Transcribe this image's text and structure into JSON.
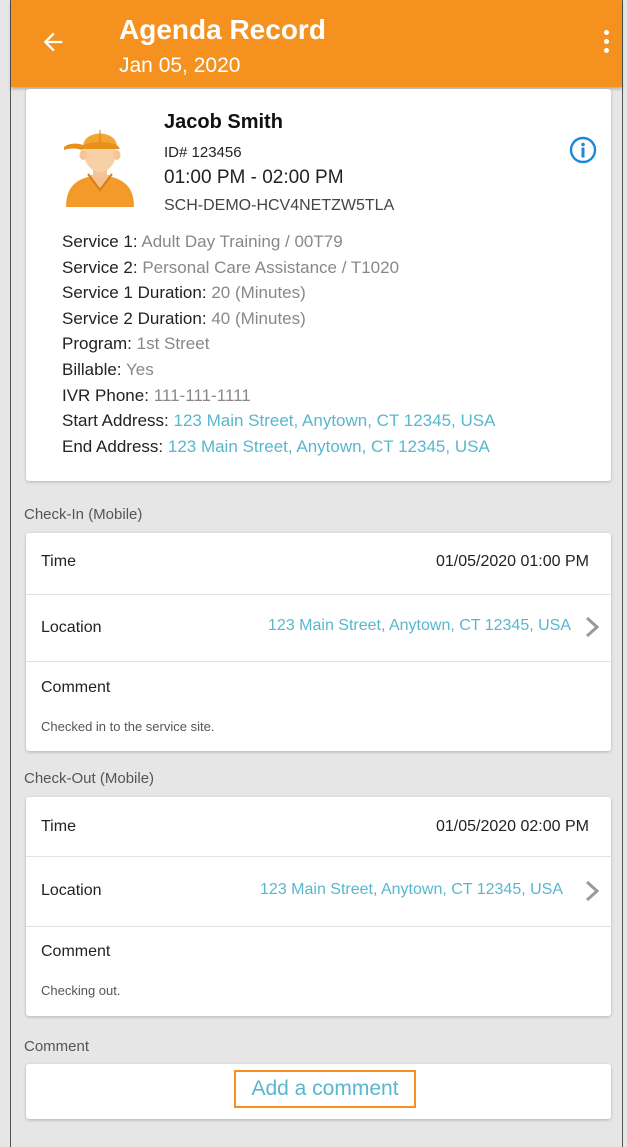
{
  "appbar": {
    "title": "Agenda Record",
    "subtitle": "Jan 05, 2020",
    "back_icon": "arrow-left-icon",
    "menu_icon": "more-vertical-icon"
  },
  "profile": {
    "name": "Jacob Smith",
    "id": "ID# 123456",
    "time_range": "01:00 PM - 02:00 PM",
    "schedule_id": "SCH-DEMO-HCV4NETZW5TLA",
    "info_icon": "info-icon"
  },
  "details": [
    {
      "label": "Service 1:",
      "value": "Adult Day Training / 00T79"
    },
    {
      "label": "Service 2:",
      "value": "Personal Care Assistance / T1020"
    },
    {
      "label": "Service 1 Duration:",
      "value": "20 (Minutes)"
    },
    {
      "label": "Service 2 Duration:",
      "value": "40 (Minutes)"
    },
    {
      "label": "Program:",
      "value": "1st Street"
    },
    {
      "label": "Billable:",
      "value": "Yes"
    },
    {
      "label": "IVR Phone:",
      "value": "111-111-1111"
    },
    {
      "label": "Start Address:",
      "value": "123 Main Street, Anytown, CT 12345, USA"
    },
    {
      "label": "End Address:",
      "value": "123 Main Street, Anytown, CT 12345, USA"
    }
  ],
  "checkin": {
    "section_label": "Check-In (Mobile)",
    "time_label": "Time",
    "time_value": "01/05/2020  01:00 PM",
    "location_label": "Location",
    "location_value": "123 Main Street, Anytown, CT 12345, USA",
    "comment_label": "Comment",
    "comment_value": "Checked in to the service site."
  },
  "checkout": {
    "section_label": "Check-Out (Mobile)",
    "time_label": "Time",
    "time_value": "01/05/2020  02:00 PM",
    "location_label": "Location",
    "location_value": "123 Main Street, Anytown, CT 12345, USA",
    "comment_label": "Comment",
    "comment_value": "Checking out."
  },
  "comment_section": {
    "section_label": "Comment",
    "add_button": "Add a comment"
  },
  "colors": {
    "brand_orange": "#f5911e",
    "link_blue": "#58b7cf"
  }
}
